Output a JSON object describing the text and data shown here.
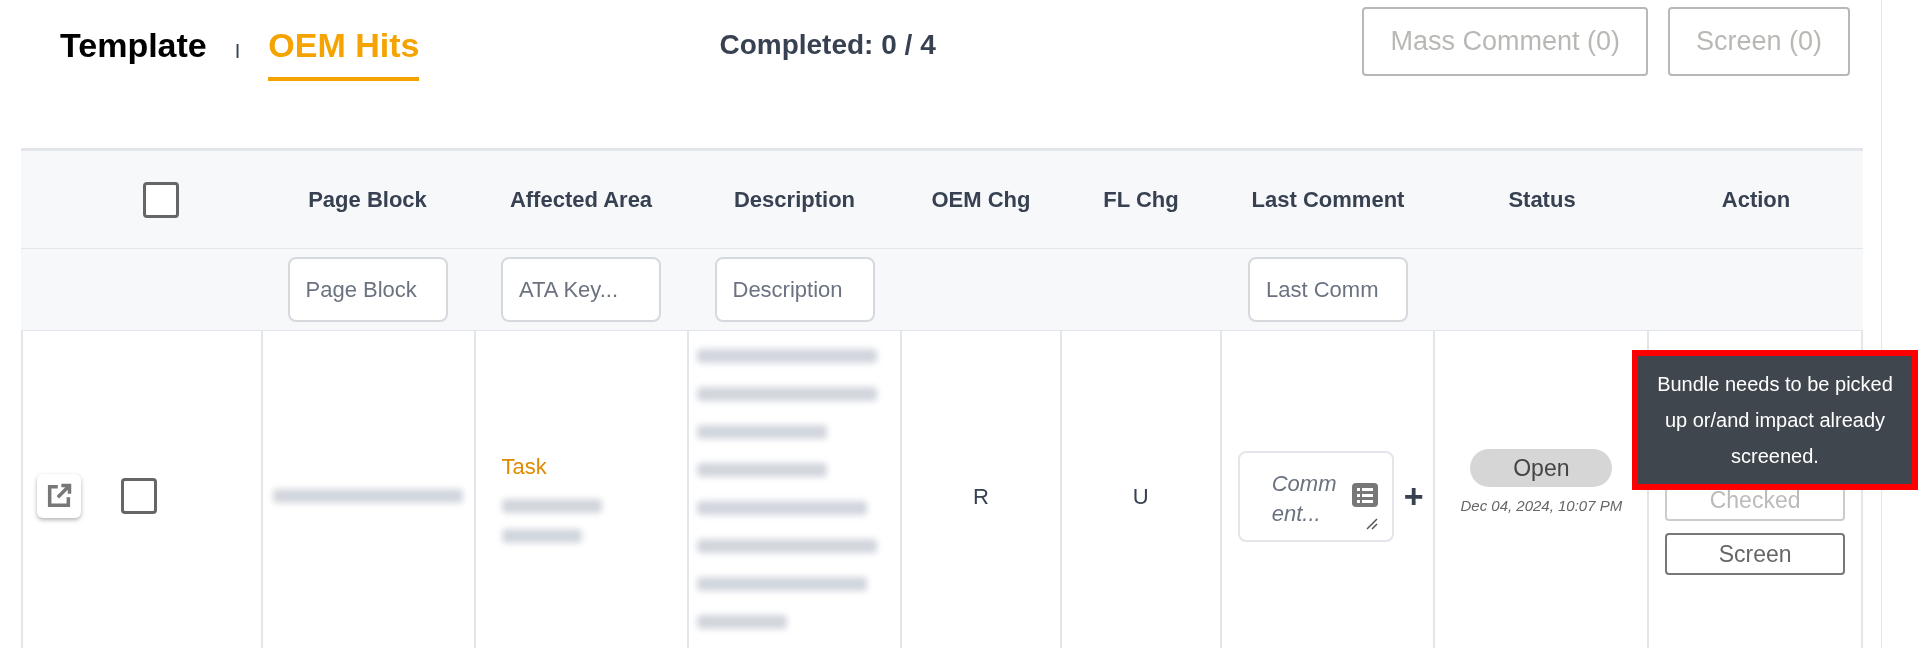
{
  "tabs": [
    {
      "label": "Template",
      "selected": false
    },
    {
      "label": "OEM Hits",
      "selected": true
    }
  ],
  "separator": "I",
  "completed": "Completed: 0 / 4",
  "toolbar_buttons": [
    {
      "label": "Mass Comment (0)",
      "disabled": true
    },
    {
      "label": "Screen (0)",
      "disabled": true
    }
  ],
  "table": {
    "select_all_checked": false,
    "columns": [
      {
        "label": "Page Block",
        "filter_placeholder": "Page Block"
      },
      {
        "label": "Affected Area",
        "filter_placeholder": "ATA Key..."
      },
      {
        "label": "Description",
        "filter_placeholder": "Description"
      },
      {
        "label": "OEM Chg"
      },
      {
        "label": "FL Chg"
      },
      {
        "label": "Last Comment",
        "filter_placeholder": "Last Comm"
      },
      {
        "label": "Status"
      },
      {
        "label": "Action"
      }
    ],
    "rows": [
      {
        "checked": false,
        "affected_area": "Task",
        "oem_chg": "R",
        "fl_chg": "U",
        "comment_placeholder": "Comment...",
        "add": "+",
        "status": "Open",
        "status_time": "Dec 04, 2024, 10:07 PM",
        "actions": [
          {
            "label": "Checked",
            "disabled": true
          },
          {
            "label": "Screen",
            "disabled": false
          }
        ]
      }
    ]
  },
  "tooltip": "Bundle needs to be picked up or/and impact already screened."
}
